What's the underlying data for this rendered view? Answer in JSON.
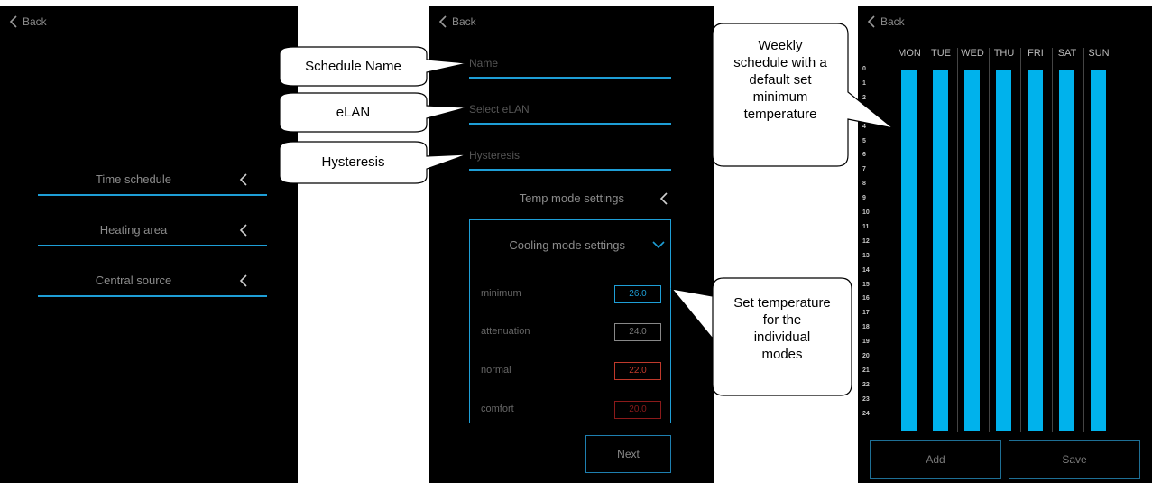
{
  "panel1": {
    "back_label": "Back",
    "menu": [
      {
        "label": "Time schedule"
      },
      {
        "label": "Heating area"
      },
      {
        "label": "Central source"
      }
    ]
  },
  "panel2": {
    "back_label": "Back",
    "name_placeholder": "Name",
    "elan_placeholder": "Select eLAN",
    "hysteresis_placeholder": "Hysteresis",
    "temp_mode_label": "Temp mode settings",
    "cooling_label": "Cooling mode settings",
    "modes": [
      {
        "label": "minimum",
        "value": "26.0",
        "color": "#1e9ed6"
      },
      {
        "label": "attenuation",
        "value": "24.0",
        "color": "#bbbbbb"
      },
      {
        "label": "normal",
        "value": "22.0",
        "color": "#c0392b"
      },
      {
        "label": "comfort",
        "value": "20.0",
        "color": "#8b1a1a"
      }
    ],
    "next_label": "Next"
  },
  "panel3": {
    "back_label": "Back",
    "days": [
      "MON",
      "TUE",
      "WED",
      "THU",
      "FRI",
      "SAT",
      "SUN"
    ],
    "hours": [
      "0",
      "1",
      "2",
      "3",
      "4",
      "5",
      "6",
      "7",
      "8",
      "9",
      "10",
      "11",
      "12",
      "13",
      "14",
      "15",
      "16",
      "17",
      "18",
      "19",
      "20",
      "21",
      "22",
      "23",
      "24"
    ],
    "add_label": "Add",
    "save_label": "Save",
    "bar_color": "#00b2ec"
  },
  "callouts": {
    "schedule_name": "Schedule Name",
    "elan": "eLAN",
    "hysteresis": "Hysteresis",
    "weekly": [
      "Weekly",
      "schedule with a",
      "default set",
      "minimum",
      "temperature"
    ],
    "set_temp": [
      "Set temperature",
      "for the",
      "individual",
      "modes"
    ]
  },
  "colors": {
    "accent": "#1e9ed6",
    "background": "#000000"
  }
}
